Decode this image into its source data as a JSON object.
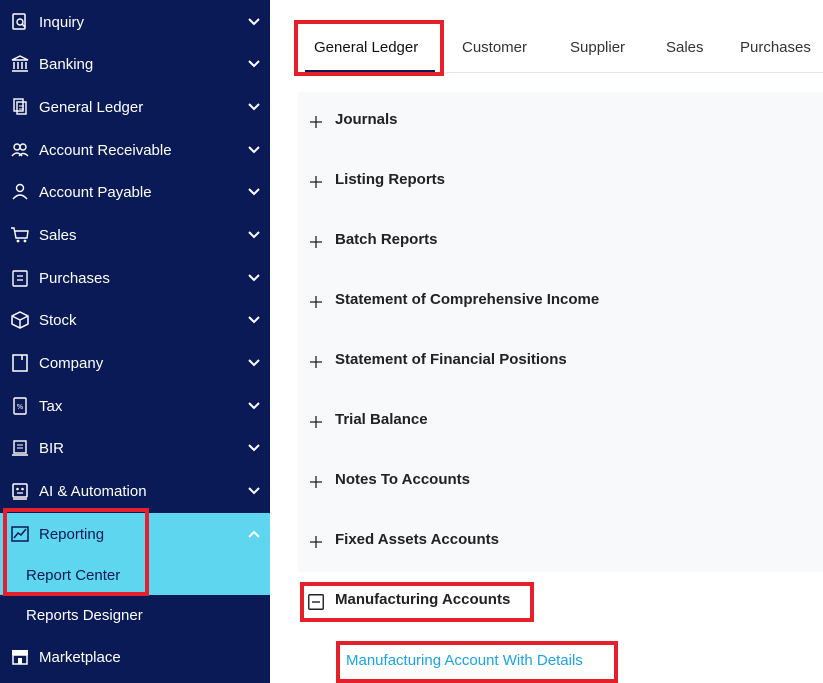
{
  "sidebar": {
    "items": [
      {
        "label": "Inquiry",
        "icon": "inquiry-icon"
      },
      {
        "label": "Banking",
        "icon": "bank-icon"
      },
      {
        "label": "General Ledger",
        "icon": "ledger-icon"
      },
      {
        "label": "Account Receivable",
        "icon": "receivable-icon"
      },
      {
        "label": "Account Payable",
        "icon": "payable-icon"
      },
      {
        "label": "Sales",
        "icon": "cart-icon"
      },
      {
        "label": "Purchases",
        "icon": "purchases-icon"
      },
      {
        "label": "Stock",
        "icon": "box-icon"
      },
      {
        "label": "Company",
        "icon": "company-icon"
      },
      {
        "label": "Tax",
        "icon": "tax-icon"
      },
      {
        "label": "BIR",
        "icon": "bir-icon"
      },
      {
        "label": "AI & Automation",
        "icon": "robot-icon"
      },
      {
        "label": "Reporting",
        "icon": "chart-icon"
      }
    ],
    "sub_items": [
      {
        "label": "Report Center"
      },
      {
        "label": "Reports Designer"
      }
    ],
    "marketplace": {
      "label": "Marketplace",
      "icon": "store-icon"
    }
  },
  "tabs": [
    "General Ledger",
    "Customer",
    "Supplier",
    "Sales",
    "Purchases"
  ],
  "sections": [
    "Journals",
    "Listing Reports",
    "Batch Reports",
    "Statement of Comprehensive Income",
    "Statement of Financial Positions",
    "Trial Balance",
    "Notes To Accounts",
    "Fixed Assets Accounts",
    "Manufacturing Accounts"
  ],
  "expanded_link": "Manufacturing Account With Details",
  "colors": {
    "sidebar_bg": "#0a1a56",
    "active_bg": "#5fd6f0",
    "highlight": "#e5202a",
    "link": "#1aa3e8"
  }
}
